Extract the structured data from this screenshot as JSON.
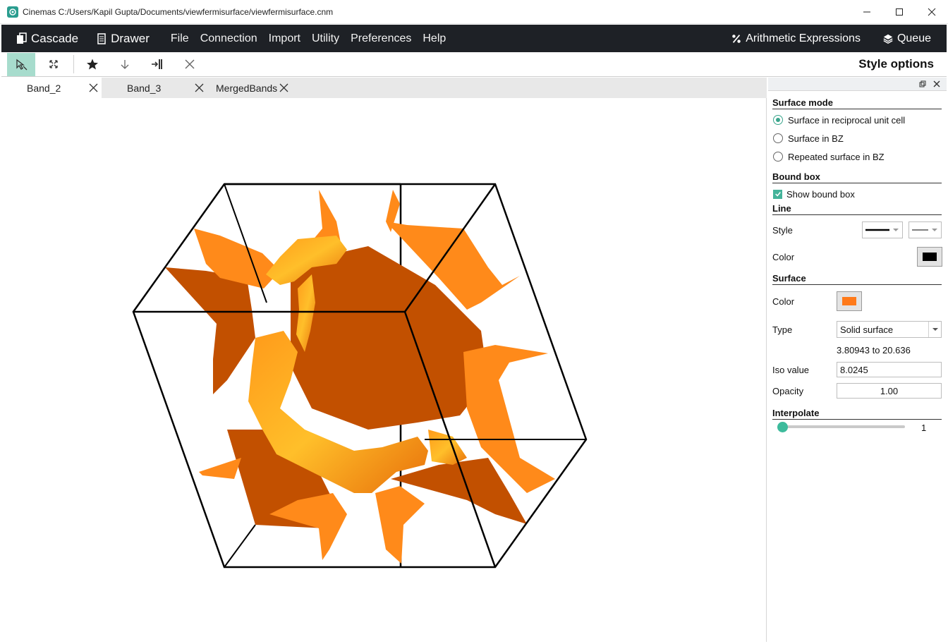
{
  "window": {
    "title": "Cinemas C:/Users/Kapil Gupta/Documents/viewfermisurface/viewfermisurface.cnm"
  },
  "menubar": {
    "brand_cascade": "Cascade",
    "brand_drawer": "Drawer",
    "items": [
      "File",
      "Connection",
      "Import",
      "Utility",
      "Preferences",
      "Help"
    ],
    "arith_label": "Arithmetic Expressions",
    "queue_label": "Queue"
  },
  "toolbar": {
    "panel_title": "Style options"
  },
  "tabs": [
    {
      "label": "Band_2",
      "active": true
    },
    {
      "label": "Band_3",
      "active": false
    },
    {
      "label": "MergedBands",
      "active": false
    }
  ],
  "style_panel": {
    "surface_mode": {
      "title": "Surface mode",
      "options": [
        "Surface in reciprocal unit cell",
        "Surface in BZ",
        "Repeated surface in BZ"
      ],
      "selected": "Surface in reciprocal unit cell"
    },
    "bound_box": {
      "title": "Bound box",
      "show_label": "Show bound box",
      "checked": true
    },
    "line": {
      "title": "Line",
      "style_label": "Style",
      "color_label": "Color",
      "color": "#000000"
    },
    "surface": {
      "title": "Surface",
      "color_label": "Color",
      "color": "#ff7a1a",
      "type_label": "Type",
      "type_value": "Solid surface",
      "range_text": "3.80943 to 20.636",
      "iso_label": "Iso value",
      "iso_value": "8.0245",
      "opacity_label": "Opacity",
      "opacity_value": "1.00"
    },
    "interpolate": {
      "title": "Interpolate",
      "value": "1",
      "min": 1,
      "max": 10
    }
  },
  "colors": {
    "menubar_bg": "#1e2126",
    "accent": "#3aa58c",
    "surface_dark": "#c25000",
    "surface_light": "#ff8a1a"
  }
}
